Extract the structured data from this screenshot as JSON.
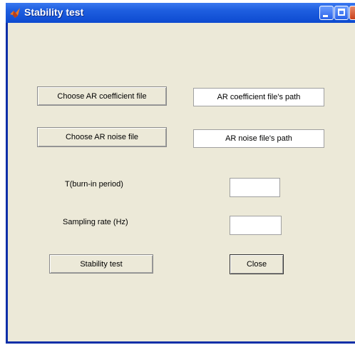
{
  "window": {
    "title": "Stability test"
  },
  "buttons": {
    "choose_ar_coefficient": "Choose AR coefficient file",
    "choose_ar_noise": "Choose AR noise file",
    "stability_test": "Stability test",
    "close": "Close"
  },
  "fields": {
    "ar_coefficient_path": "AR coefficient file's path",
    "ar_noise_path": "AR noise file's path",
    "burn_in_value": "",
    "sampling_rate_value": ""
  },
  "labels": {
    "burn_in": "T(burn-in period)",
    "sampling_rate": "Sampling rate (Hz)"
  },
  "icons": {
    "app": "matlab-icon",
    "minimize": "minimize-icon",
    "maximize": "maximize-icon",
    "close": "close-icon"
  }
}
